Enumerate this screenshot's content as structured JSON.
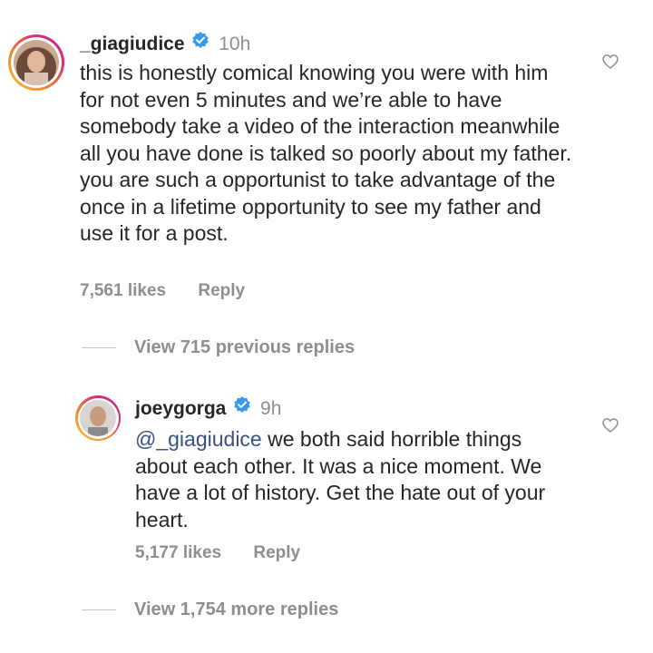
{
  "comment1": {
    "username": "_giagiudice",
    "time": "10h",
    "text": "this is honestly comical knowing you were with him for not even 5 minutes and we’re able to have somebody take a video of the interaction meanwhile all you have done is talked so poorly about my father. you are such a opportunist to take advantage of the once in a lifetime opportunity to see my father and use it for a post.",
    "likes": "7,561 likes",
    "reply_label": "Reply"
  },
  "view_previous": "View 715 previous replies",
  "comment2": {
    "username": "joeygorga",
    "time": "9h",
    "mention": "@_giagiudice",
    "text": " we both said horrible things about each other. It was a nice moment. We have a lot of history. Get the hate out of your heart.",
    "likes": "5,177 likes",
    "reply_label": "Reply"
  },
  "view_more": "View 1,754 more replies",
  "colors": {
    "verified": "#3897f0",
    "muted": "#8e8e8e",
    "mention": "#385185"
  }
}
